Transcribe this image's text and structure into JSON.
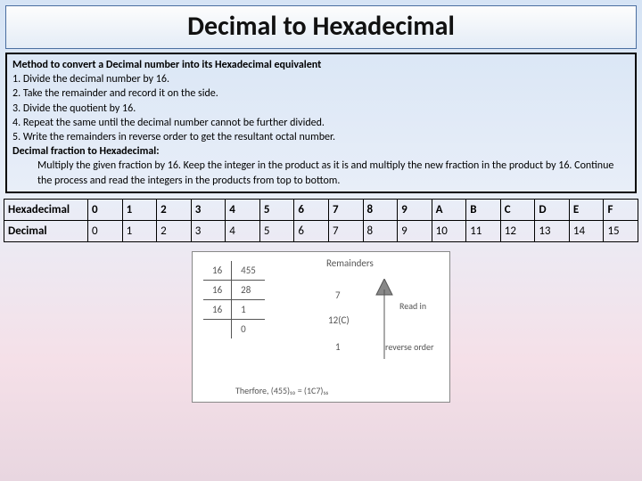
{
  "title": "Decimal to Hexadecimal",
  "method": {
    "heading": "Method to convert a Decimal number into its Hexadecimal equivalent",
    "steps": [
      "1. Divide the decimal number by 16.",
      "2. Take the remainder and record it on the side.",
      "3. Divide the quotient by 16.",
      "4. Repeat the same until the decimal number cannot be further divided.",
      "5. Write the remainders in reverse order to get the resultant octal number."
    ],
    "fraction_heading": "Decimal fraction to Hexadecimal:",
    "fraction_body": "Multiply the given fraction by 16. Keep the integer in the product as it is and multiply the new fraction in the product by 16. Continue the process and read the integers in the products from top to bottom."
  },
  "table": {
    "row1label": "Hexadecimal",
    "row2label": "Decimal",
    "hex": [
      "0",
      "1",
      "2",
      "3",
      "4",
      "5",
      "6",
      "7",
      "8",
      "9",
      "A",
      "B",
      "C",
      "D",
      "E",
      "F"
    ],
    "dec": [
      "0",
      "1",
      "2",
      "3",
      "4",
      "5",
      "6",
      "7",
      "8",
      "9",
      "10",
      "11",
      "12",
      "13",
      "14",
      "15"
    ]
  },
  "diagram": {
    "divisor": "16",
    "quotients": [
      "455",
      "28",
      "1",
      "0"
    ],
    "remainders_label": "Remainders",
    "remainders": [
      "7",
      "12(C)",
      "1"
    ],
    "read_in": "Read in",
    "reverse_order": "reverse order",
    "conclusion": "Therfore, (455)₁₀ = (1C7)₁₆"
  }
}
